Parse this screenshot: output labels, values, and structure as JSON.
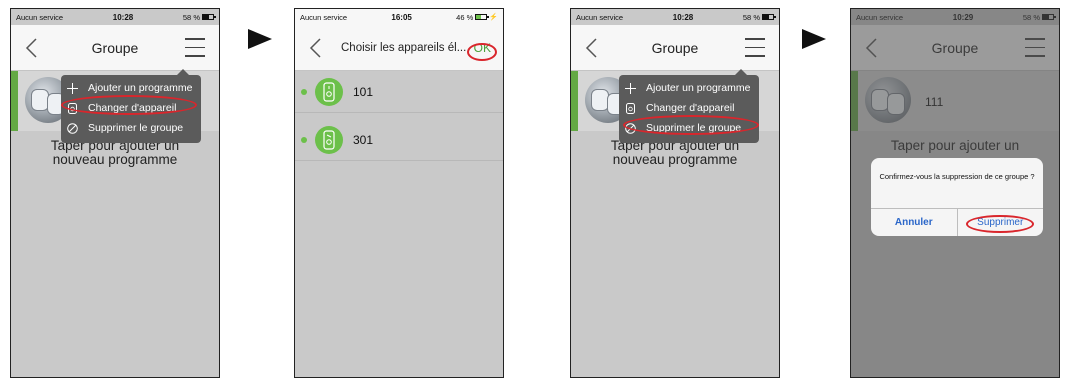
{
  "colors": {
    "accent_green": "#63a944",
    "highlight_red": "#d9262c",
    "menu_bg": "#5b5b5b",
    "dialog_link": "#2a66c9"
  },
  "screens": [
    {
      "status": {
        "carrier": "Aucun service",
        "time": "10:28",
        "battery": "58 %"
      },
      "nav": {
        "title": "Groupe"
      },
      "group": {
        "name": ""
      },
      "prompt": {
        "line1": "Taper pour ajouter un",
        "line2": "nouveau programme"
      },
      "menu": [
        {
          "label": "Ajouter un programme",
          "icon": "plus-icon"
        },
        {
          "label": "Changer d'appareil",
          "icon": "plug-icon"
        },
        {
          "label": "Supprimer le groupe",
          "icon": "prohibit-icon"
        }
      ]
    },
    {
      "status": {
        "carrier": "Aucun service",
        "time": "16:05",
        "battery": "46 %"
      },
      "nav": {
        "title": "Choisir les appareils él...",
        "ok": "OK"
      },
      "devices": [
        {
          "label": "101"
        },
        {
          "label": "301"
        }
      ]
    },
    {
      "status": {
        "carrier": "Aucun service",
        "time": "10:28",
        "battery": "58 %"
      },
      "nav": {
        "title": "Groupe"
      },
      "prompt": {
        "line1": "Taper pour ajouter un",
        "line2": "nouveau programme"
      },
      "menu": [
        {
          "label": "Ajouter un programme",
          "icon": "plus-icon"
        },
        {
          "label": "Changer d'appareil",
          "icon": "plug-icon"
        },
        {
          "label": "Supprimer le groupe",
          "icon": "prohibit-icon"
        }
      ]
    },
    {
      "status": {
        "carrier": "Aucun service",
        "time": "10:29",
        "battery": "58 %"
      },
      "nav": {
        "title": "Groupe"
      },
      "group": {
        "name": "111"
      },
      "prompt": {
        "line1": "Taper pour ajouter un"
      },
      "dialog": {
        "message": "Confirmez-vous la suppression de ce groupe ?",
        "cancel": "Annuler",
        "confirm": "Supprimer"
      }
    }
  ]
}
